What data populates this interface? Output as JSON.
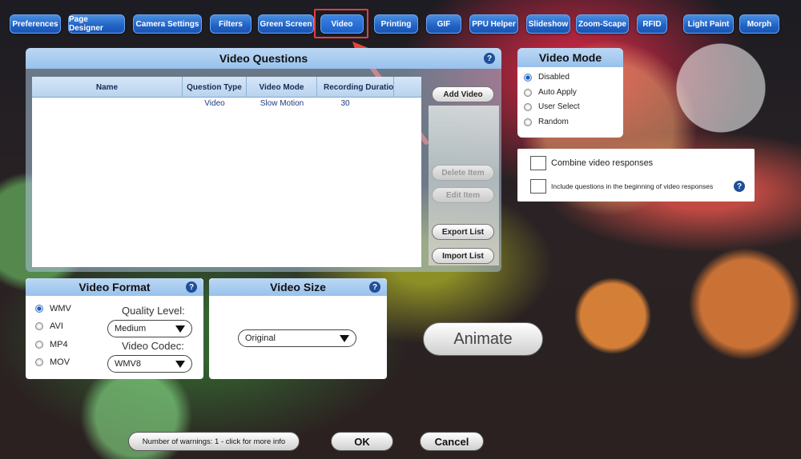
{
  "nav": {
    "items": [
      {
        "label": "Preferences"
      },
      {
        "label": "Page Designer"
      },
      {
        "label": "Camera Settings"
      },
      {
        "label": "Filters"
      },
      {
        "label": "Green Screen"
      },
      {
        "label": "Video"
      },
      {
        "label": "Printing"
      },
      {
        "label": "GIF"
      },
      {
        "label": "PPU Helper"
      },
      {
        "label": "Slideshow"
      },
      {
        "label": "Zoom-Scape"
      },
      {
        "label": "RFID"
      },
      {
        "label": "Light Paint"
      },
      {
        "label": "Morph"
      }
    ],
    "active": "Video"
  },
  "video_questions": {
    "title": "Video Questions",
    "help_icon": "?",
    "columns": [
      "Name",
      "Question Type",
      "Video Mode",
      "Recording Duratio"
    ],
    "rows": [
      {
        "name": "",
        "question_type": "Video",
        "video_mode": "Slow Motion",
        "duration": "30"
      }
    ],
    "buttons": {
      "add": "Add Video",
      "delete": "Delete Item",
      "edit": "Edit Item",
      "export": "Export List",
      "import": "Import List"
    }
  },
  "video_mode": {
    "title": "Video Mode",
    "options": [
      "Disabled",
      "Auto Apply",
      "User Select",
      "Random"
    ],
    "selected": "Disabled"
  },
  "combine": {
    "combine_label": "Combine video responses",
    "include_label": "Include questions in the beginning of video responses",
    "help_icon": "?"
  },
  "video_format": {
    "title": "Video Format",
    "help_icon": "?",
    "options": [
      "WMV",
      "AVI",
      "MP4",
      "MOV"
    ],
    "selected": "WMV",
    "quality_label": "Quality Level:",
    "quality_value": "Medium",
    "codec_label": "Video Codec:",
    "codec_value": "WMV8"
  },
  "video_size": {
    "title": "Video Size",
    "help_icon": "?",
    "value": "Original"
  },
  "animate_label": "Animate",
  "bottom": {
    "warnings": "Number of warnings: 1 - click for more info",
    "ok": "OK",
    "cancel": "Cancel"
  },
  "colors": {
    "nav_blue": "#2162c6",
    "header_blue": "#a9cdf0",
    "highlight_red": "#e04040"
  }
}
